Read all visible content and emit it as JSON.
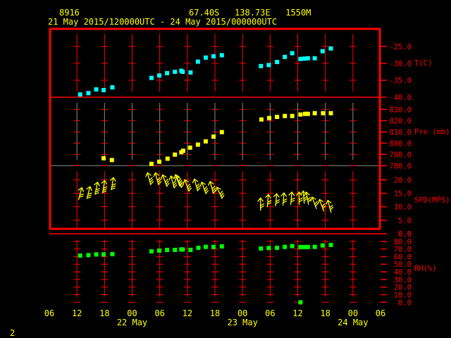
{
  "header": {
    "station": "8916",
    "location": "67.40S   138.73E   1550M",
    "time_range": "21 May 2015/120000UTC - 24 May 2015/000000UTC"
  },
  "footer": {
    "page": "2"
  },
  "colors": {
    "frame": "#ff0000",
    "axis_text": "#ff0000",
    "title": "#ffff00",
    "temp": "#00ffff",
    "pressure": "#ffff00",
    "wind": "#ffff00",
    "rh": "#00ff00",
    "grid_alt": "#8a8a8a"
  },
  "chart_data": {
    "type": "scatter",
    "title": "8916 67.40S 138.73E 1550M",
    "x_unit": "hours since 21 May 2015 06Z",
    "xlim": [
      0,
      72
    ],
    "x_ticks": [
      "06",
      "12",
      "18",
      "00",
      "06",
      "12",
      "18",
      "00",
      "06",
      "12",
      "18",
      "00",
      "06"
    ],
    "date_labels": [
      {
        "label": "22 May",
        "hour": 18
      },
      {
        "label": "23 May",
        "hour": 42
      },
      {
        "label": "24 May",
        "hour": 66
      }
    ],
    "panels": [
      {
        "name": "T(C)",
        "kind": "points",
        "ylim": [
          -40,
          -19.6
        ],
        "ticks": [
          {
            "v": -25,
            "label": "-25.0"
          },
          {
            "v": -30,
            "label": "-30.0"
          },
          {
            "v": -35,
            "label": "-35.0"
          },
          {
            "v": -40,
            "label": "-40.0"
          }
        ],
        "x": [
          6.7,
          8.5,
          10.2,
          11.8,
          13.7,
          22.2,
          23.9,
          25.6,
          27.3,
          28.7,
          29.0,
          30.7,
          32.3,
          34.0,
          35.7,
          37.5,
          46.0,
          47.7,
          49.5,
          51.2,
          52.8,
          54.6,
          55.4,
          56.2,
          57.7,
          59.4,
          61.2
        ],
        "y": [
          -39.2,
          -38.8,
          -37.7,
          -37.9,
          -37.1,
          -34.3,
          -33.6,
          -32.9,
          -32.5,
          -32.2,
          -32.5,
          -32.7,
          -29.5,
          -28.3,
          -27.9,
          -27.6,
          -30.8,
          -30.5,
          -29.6,
          -28.1,
          -27.0,
          -28.7,
          -28.6,
          -28.5,
          -28.5,
          -26.4,
          -25.6
        ]
      },
      {
        "name": "Pre (mb)",
        "kind": "points",
        "ylim": [
          780,
          840.8
        ],
        "ticks": [
          {
            "v": 780,
            "label": "780.0"
          },
          {
            "v": 790,
            "label": "790.0"
          },
          {
            "v": 800,
            "label": "800.0"
          },
          {
            "v": 810,
            "label": "810.0"
          },
          {
            "v": 820,
            "label": "820.0"
          },
          {
            "v": 830,
            "label": "830.0"
          }
        ],
        "x": [
          11.8,
          13.6,
          22.2,
          23.9,
          25.7,
          27.3,
          28.7,
          29.1,
          30.6,
          32.3,
          34.0,
          35.7,
          37.5,
          46.1,
          47.8,
          49.5,
          51.2,
          52.8,
          54.6,
          55.6,
          56.2,
          57.7,
          59.5,
          61.2
        ],
        "y": [
          786.6,
          785.0,
          781.6,
          783.5,
          786.2,
          789.8,
          791.9,
          793.3,
          796.0,
          798.7,
          801.6,
          805.8,
          809.8,
          821.0,
          822.3,
          823.3,
          824.1,
          824.1,
          825.4,
          826.0,
          826.0,
          826.6,
          826.6,
          826.6
        ]
      },
      {
        "name": "SPD(MPS)",
        "kind": "wind",
        "ylim": [
          0,
          25.2
        ],
        "ticks": [
          {
            "v": 0,
            "label": "0.0"
          },
          {
            "v": 5,
            "label": "5.0"
          },
          {
            "v": 10,
            "label": "10.0"
          },
          {
            "v": 15,
            "label": "15.0"
          },
          {
            "v": 20,
            "label": "20.0"
          }
        ],
        "x": [
          6.7,
          8.5,
          10.2,
          11.8,
          13.7,
          21.7,
          23.4,
          25.1,
          26.8,
          27.9,
          28.2,
          29.9,
          31.9,
          33.6,
          35.3,
          37.0,
          45.9,
          47.5,
          49.3,
          50.9,
          52.6,
          54.3,
          55.3,
          56.1,
          57.6,
          59.2,
          60.9
        ],
        "y": [
          14.8,
          15.2,
          16.8,
          17.4,
          18.5,
          20.3,
          20.3,
          19.6,
          19.1,
          19.7,
          19.1,
          17.8,
          18.0,
          16.9,
          17.1,
          15.1,
          10.9,
          12.2,
          12.5,
          12.8,
          13.1,
          13.1,
          13.5,
          13.1,
          11.4,
          10.5,
          10.1
        ],
        "direction_deg": [
          15,
          15,
          12,
          10,
          10,
          345,
          345,
          340,
          345,
          340,
          335,
          340,
          345,
          340,
          345,
          335,
          0,
          5,
          5,
          5,
          5,
          0,
          355,
          350,
          340,
          340,
          345
        ]
      },
      {
        "name": "RH(%)",
        "kind": "points",
        "ylim": [
          0,
          90
        ],
        "ticks": [
          {
            "v": 0,
            "label": "0.0"
          },
          {
            "v": 10,
            "label": "10.0"
          },
          {
            "v": 20,
            "label": "20.0"
          },
          {
            "v": 30,
            "label": "30.0"
          },
          {
            "v": 40,
            "label": "40.0"
          },
          {
            "v": 50,
            "label": "50.0"
          },
          {
            "v": 60,
            "label": "60.0"
          },
          {
            "v": 70,
            "label": "70.0"
          },
          {
            "v": 80,
            "label": "80.0"
          },
          {
            "v": 90,
            "label": "0.0"
          }
        ],
        "x": [
          6.7,
          8.5,
          10.2,
          11.8,
          13.7,
          22.2,
          23.9,
          25.6,
          27.3,
          28.7,
          29.0,
          30.7,
          32.4,
          34.0,
          35.7,
          37.5,
          46.0,
          47.7,
          49.5,
          51.2,
          52.8,
          54.6,
          55.4,
          56.2,
          57.7,
          59.4,
          61.2,
          54.6
        ],
        "y": [
          61.4,
          62.0,
          62.9,
          62.9,
          63.3,
          67.0,
          67.9,
          68.8,
          68.8,
          69.4,
          69.4,
          68.8,
          71.6,
          72.8,
          72.8,
          73.5,
          70.7,
          71.3,
          71.6,
          72.8,
          73.8,
          72.6,
          72.6,
          72.6,
          72.8,
          74.7,
          75.3,
          0
        ]
      }
    ]
  }
}
